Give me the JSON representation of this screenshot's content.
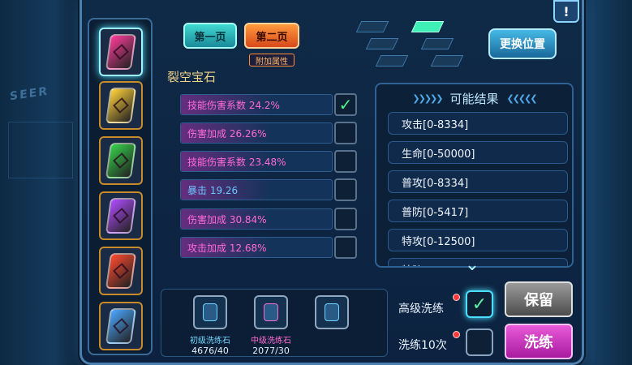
{
  "page_buttons": {
    "page1": "第一页",
    "page2": "第二页",
    "attr_tag": "附加属性"
  },
  "swap_button": "更换位置",
  "section_title": "裂空宝石",
  "attributes": [
    {
      "text": "技能伤害系数 24.2%",
      "checked": true
    },
    {
      "text": "伤害加成 26.26%",
      "checked": false
    },
    {
      "text": "技能伤害系数 23.48%",
      "checked": false
    },
    {
      "text": "暴击 19.26",
      "checked": false
    },
    {
      "text": "伤害加成 30.84%",
      "checked": false
    },
    {
      "text": "攻击加成 12.68%",
      "checked": false
    }
  ],
  "results": {
    "title": "可能结果",
    "items": [
      "攻击[0-8334]",
      "生命[0-50000]",
      "普攻[0-8334]",
      "普防[0-5417]",
      "特攻[0-12500]",
      "特防"
    ]
  },
  "stones": [
    {
      "name": "初级洗练石",
      "count": "4676/40",
      "color": "#6fd6ff"
    },
    {
      "name": "中级洗练石",
      "count": "2077/30",
      "color": "#ff6ad5"
    },
    {
      "name": "",
      "count": "",
      "color": "#6fd6ff"
    }
  ],
  "options": {
    "advanced_label": "高级洗练",
    "advanced_checked": true,
    "ten_label": "洗练10次",
    "ten_checked": false
  },
  "keep_button": "保留",
  "refine_button": "洗练",
  "info_icon": "!",
  "background_text": "SEER",
  "gems": [
    {
      "icon": "pink-gem-icon",
      "color": "#ff3c9a",
      "active": true
    },
    {
      "icon": "yellow-gem-icon",
      "color": "#ffd23a",
      "active": false
    },
    {
      "icon": "green-gem-icon",
      "color": "#36d24a",
      "active": false
    },
    {
      "icon": "purple-gem-icon",
      "color": "#b04cff",
      "active": false
    },
    {
      "icon": "red-gem-icon",
      "color": "#ff4a2e",
      "active": false
    },
    {
      "icon": "blue-gem-icon",
      "color": "#4aa8ff",
      "active": false
    }
  ]
}
